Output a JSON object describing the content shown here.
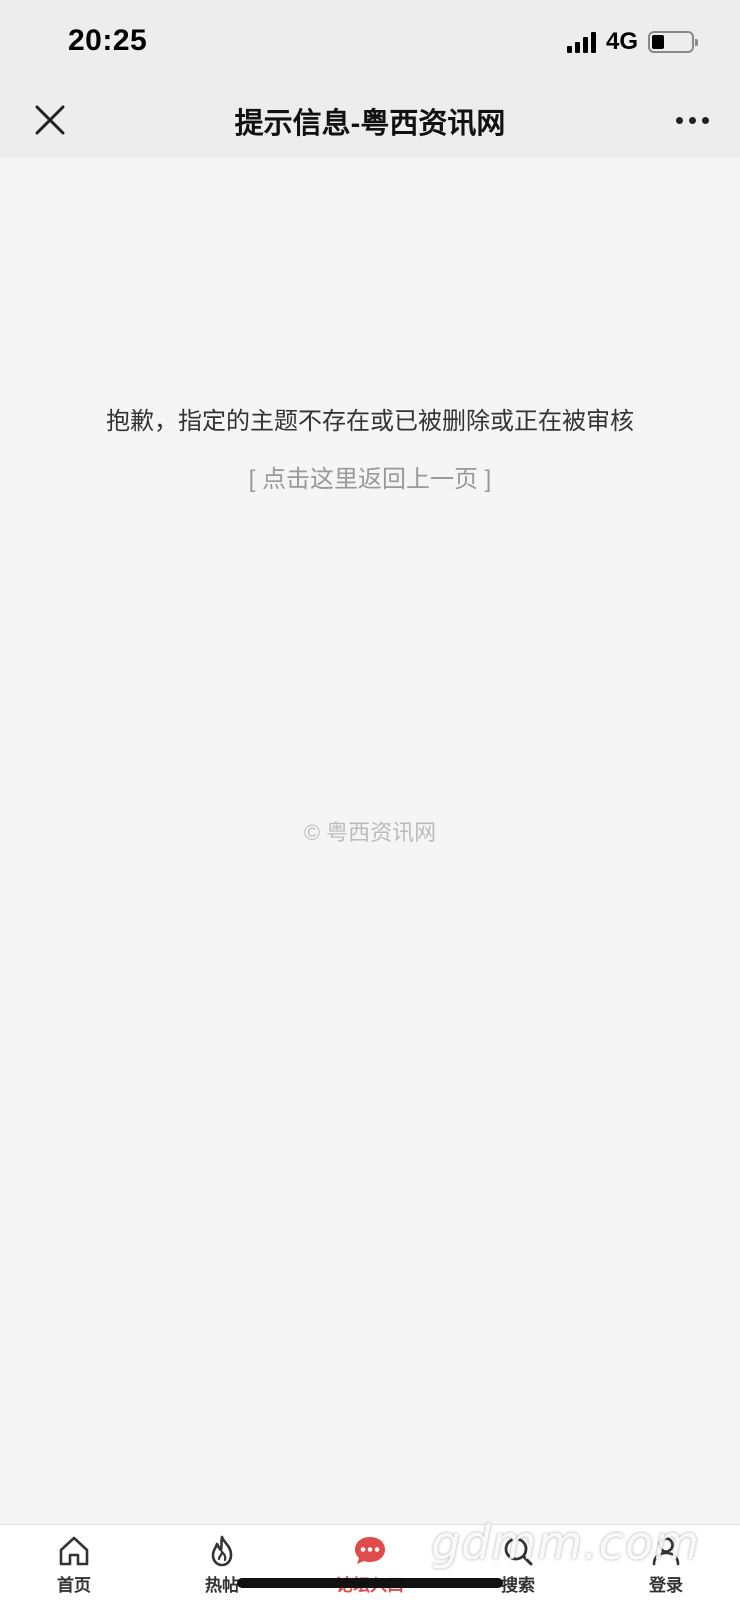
{
  "status_bar": {
    "time": "20:25",
    "network": "4G",
    "signal_bars": 4,
    "battery_level": 0.25
  },
  "title_bar": {
    "title": "提示信息-粤西资讯网",
    "close_icon": "close-icon",
    "more_icon": "more-dots-icon"
  },
  "content": {
    "message": "抱歉，指定的主题不存在或已被删除或正在被审核",
    "back_link": "[ 点击这里返回上一页 ]",
    "copyright": "© 粤西资讯网"
  },
  "tab_bar": {
    "tabs": [
      {
        "label": "首页",
        "icon": "home-icon"
      },
      {
        "label": "热帖",
        "icon": "flame-icon"
      },
      {
        "label": "论坛入口",
        "icon": "chat-bubble-icon",
        "active": true
      },
      {
        "label": "搜索",
        "icon": "search-icon"
      },
      {
        "label": "登录",
        "icon": "user-icon"
      }
    ]
  },
  "watermark": "gdmm.com",
  "colors": {
    "accent": "#e04b4b",
    "background": "#f5f5f5",
    "header": "#ededed"
  }
}
